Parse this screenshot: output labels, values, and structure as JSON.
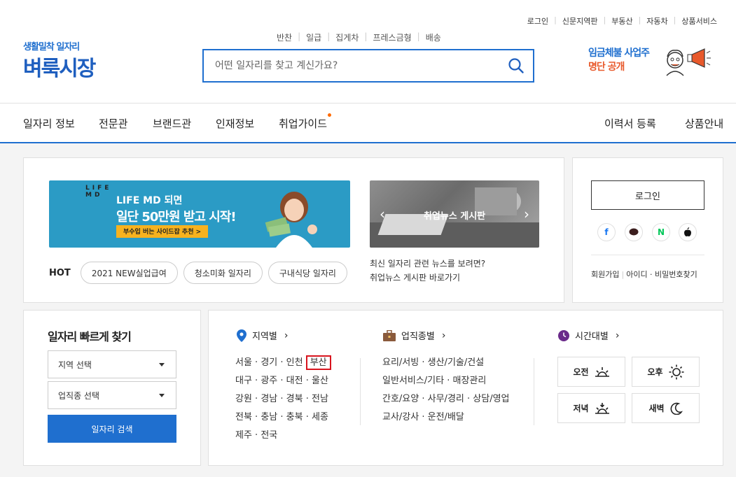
{
  "util_links": [
    "로그인",
    "신문지역판",
    "부동산",
    "자동차",
    "상품서비스"
  ],
  "logo": {
    "sub": "생활밀착 일자리",
    "main": "벼룩시장"
  },
  "quick_links": [
    "반찬",
    "일급",
    "집게차",
    "프레스금형",
    "배송"
  ],
  "search": {
    "placeholder": "어떤 일자리를 찾고 계신가요?"
  },
  "promo": {
    "line1": "임금체불 사업주",
    "line2": "명단 공개"
  },
  "gnb": {
    "left": [
      "일자리 정보",
      "전문관",
      "브랜드관",
      "인재정보",
      "취업가이드"
    ],
    "right": [
      "이력서 등록",
      "상품안내"
    ]
  },
  "banner": {
    "brand": "LIFE\nMD",
    "line1": "LIFE MD 되면",
    "line2": "일단 50만원 받고 시작!",
    "button": "부수입 버는 사이드잡 추천 >"
  },
  "news_banner": {
    "caption": "취업뉴스 게시판",
    "desc1": "최신 일자리 관련 뉴스를 보려면?",
    "desc2": "취업뉴스 게시판 바로가기"
  },
  "hot": {
    "label": "HOT",
    "tags": [
      "2021 NEW실업급여",
      "청소미화 일자리",
      "구내식당 일자리"
    ]
  },
  "login": {
    "button": "로그인",
    "social": [
      "f",
      "talk",
      "N",
      "apple"
    ],
    "links": [
      "회원가입",
      "아이디 · 비밀번호찾기"
    ]
  },
  "quick_find": {
    "title": "일자리 빠르게 찾기",
    "region_select": "지역 선택",
    "job_select": "업직종 선택",
    "button": "일자리 검색"
  },
  "region": {
    "title": "지역별",
    "rows": [
      [
        "서울",
        "경기",
        "인천",
        "부산"
      ],
      [
        "대구",
        "광주",
        "대전",
        "울산"
      ],
      [
        "강원",
        "경남",
        "경북",
        "전남"
      ],
      [
        "전북",
        "충남",
        "충북",
        "세종"
      ],
      [
        "제주",
        "전국"
      ]
    ],
    "highlighted": "부산"
  },
  "industry": {
    "title": "업직종별",
    "rows": [
      [
        "요리/서빙",
        "생산/기술/건설"
      ],
      [
        "일반서비스/기타",
        "매장관리"
      ],
      [
        "간호/요양",
        "사무/경리",
        "상담/영업"
      ],
      [
        "교사/강사",
        "운전/배달"
      ]
    ]
  },
  "time": {
    "title": "시간대별",
    "slots": [
      "오전",
      "오후",
      "저녁",
      "새벽"
    ]
  },
  "colors": {
    "brand": "#1f6fcf",
    "accent": "#e8592b",
    "highlight": "#d8141e"
  }
}
